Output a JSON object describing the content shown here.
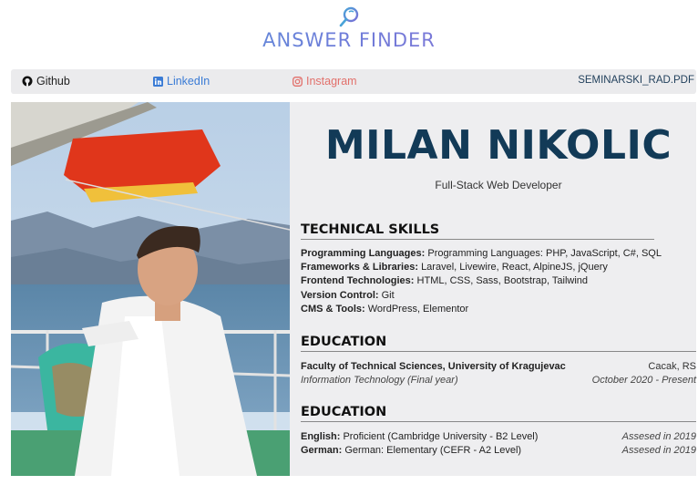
{
  "brand": {
    "wordmark": "ANSWER FINDER"
  },
  "nav": {
    "github": "Github",
    "linkedin": "LinkedIn",
    "instagram": "Instagram",
    "pdf": "SEMINARSKI_RAD.PDF"
  },
  "profile": {
    "name": "MILAN NIKOLIC",
    "role": "Full-Stack Web Developer"
  },
  "skills": {
    "title": "TECHNICAL SKILLS",
    "items": [
      {
        "label": "Programming Languages:",
        "value": "Programming Languages: PHP, JavaScript, C#, SQL"
      },
      {
        "label": "Frameworks & Libraries:",
        "value": "Laravel, Livewire, React, AlpineJS, jQuery"
      },
      {
        "label": "Frontend Technologies:",
        "value": "HTML, CSS, Sass, Bootstrap, Tailwind"
      },
      {
        "label": "Version Control:",
        "value": "Git"
      },
      {
        "label": "CMS & Tools:",
        "value": "WordPress, Elementor"
      }
    ]
  },
  "education": {
    "title": "EDUCATION",
    "school": "Faculty of Technical Sciences, University of Kragujevac",
    "location": "Cacak, RS",
    "program": "Information Technology (Final year)",
    "period": "October 2020 - Present"
  },
  "languages": {
    "title": "EDUCATION",
    "items": [
      {
        "label": "English:",
        "value": "Proficient (Cambridge University - B2 Level)",
        "note": "Assesed in 2019"
      },
      {
        "label": "German:",
        "value": "German: Elementary (CEFR - A2 Level)",
        "note": "Assesed in 2019"
      }
    ]
  }
}
